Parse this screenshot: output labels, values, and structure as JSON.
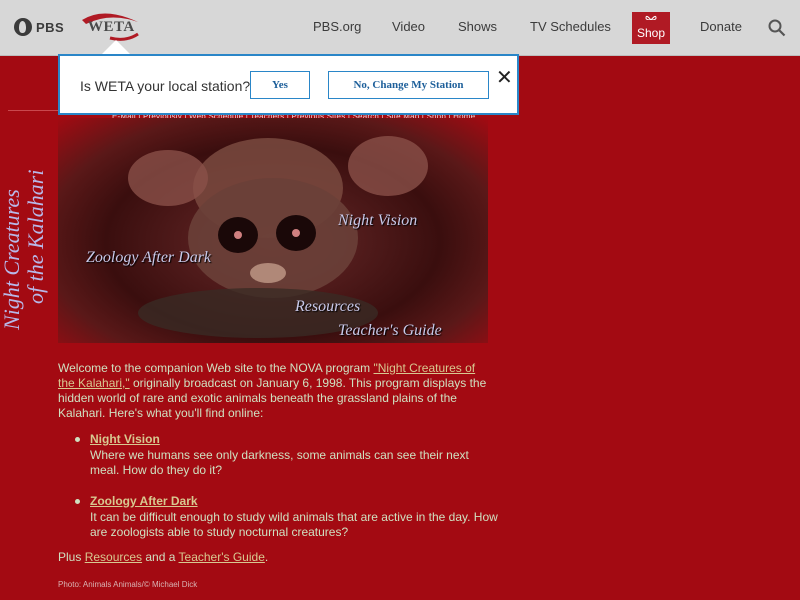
{
  "topbar": {
    "pbs_label": "PBS",
    "weta_label": "WETA",
    "nav": [
      "PBS.org",
      "Video",
      "Shows",
      "TV Schedules"
    ],
    "shop_label": "Shop",
    "donate_label": "Donate",
    "icons": {
      "search": "search-icon",
      "gift": "gift-icon"
    },
    "shop_color": "#b01a24"
  },
  "popup": {
    "question": "Is WETA your local station?",
    "yes_label": "Yes",
    "change_label": "No, Change My Station",
    "close_label": "✕",
    "border_color": "#2a86c8"
  },
  "page": {
    "vertical_title_line1": "Night Creatures",
    "vertical_title_line2": "of the Kalahari",
    "subnav": "E-Mail  |  Previously  |  Web Schedule  |  Teachers  |  Previous Sites  |  Search  |  Site Map  |  Shop  |  Home",
    "hero_links": [
      "Night Vision",
      "Zoology After Dark",
      "Resources",
      "Teacher's Guide"
    ],
    "intro_before_link": "Welcome to the companion Web site to the NOVA program ",
    "intro_link": "\"Night Creatures of the Kalahari,\"",
    "intro_after_link": " originally broadcast on January 6, 1998. This program displays the hidden world of rare and exotic animals beneath the grassland plains of the Kalahari. Here's what you'll find online:",
    "items": [
      {
        "title": "Night Vision",
        "desc": "Where we humans see only darkness, some animals can see their next meal. How do they do it?"
      },
      {
        "title": "Zoology After Dark",
        "desc": "It can be difficult enough to study wild animals that are active in the day. How are zoologists able to study nocturnal creatures?"
      }
    ],
    "plus_prefix": "Plus ",
    "plus_resources": "Resources",
    "plus_middle": " and a ",
    "plus_guide": "Teacher's Guide",
    "plus_suffix": ".",
    "credit": "Photo: Animals Animals/© Michael Dick",
    "background_color": "#a30a12"
  }
}
